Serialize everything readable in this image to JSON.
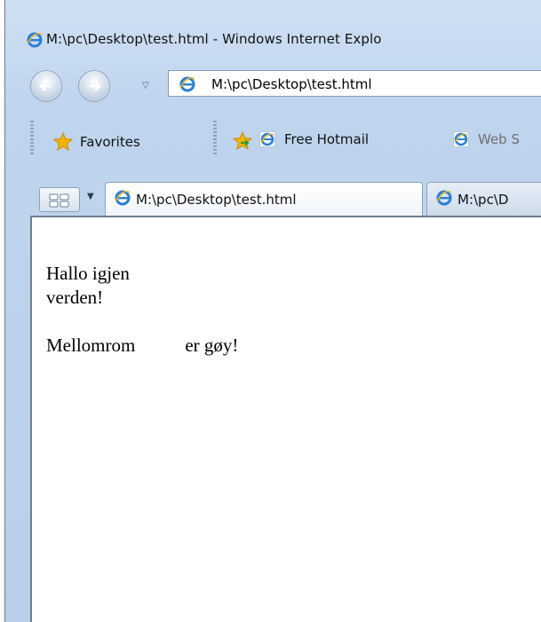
{
  "window": {
    "title": "M:\\pc\\Desktop\\test.html - Windows Internet Explo"
  },
  "nav": {
    "back_icon": "back-arrow-icon",
    "forward_icon": "forward-arrow-icon",
    "address": "M:\\pc\\Desktop\\test.html"
  },
  "favorites_bar": {
    "favorites_label": "Favorites",
    "links": [
      {
        "label": "Free Hotmail"
      },
      {
        "label": "Web S"
      }
    ]
  },
  "tabs": [
    {
      "label": "M:\\pc\\Desktop\\test.html",
      "active": true
    },
    {
      "label": "M:\\pc\\D",
      "active": false
    }
  ],
  "page": {
    "line1": "Hallo igjen",
    "line2": "verden!",
    "line3_word1": "Mellomrom",
    "line3_word2": "er gøy!"
  },
  "colors": {
    "chrome": "#bfd5ee",
    "ie_blue": "#2a7fd4",
    "favorites_star": "#f5b400"
  }
}
